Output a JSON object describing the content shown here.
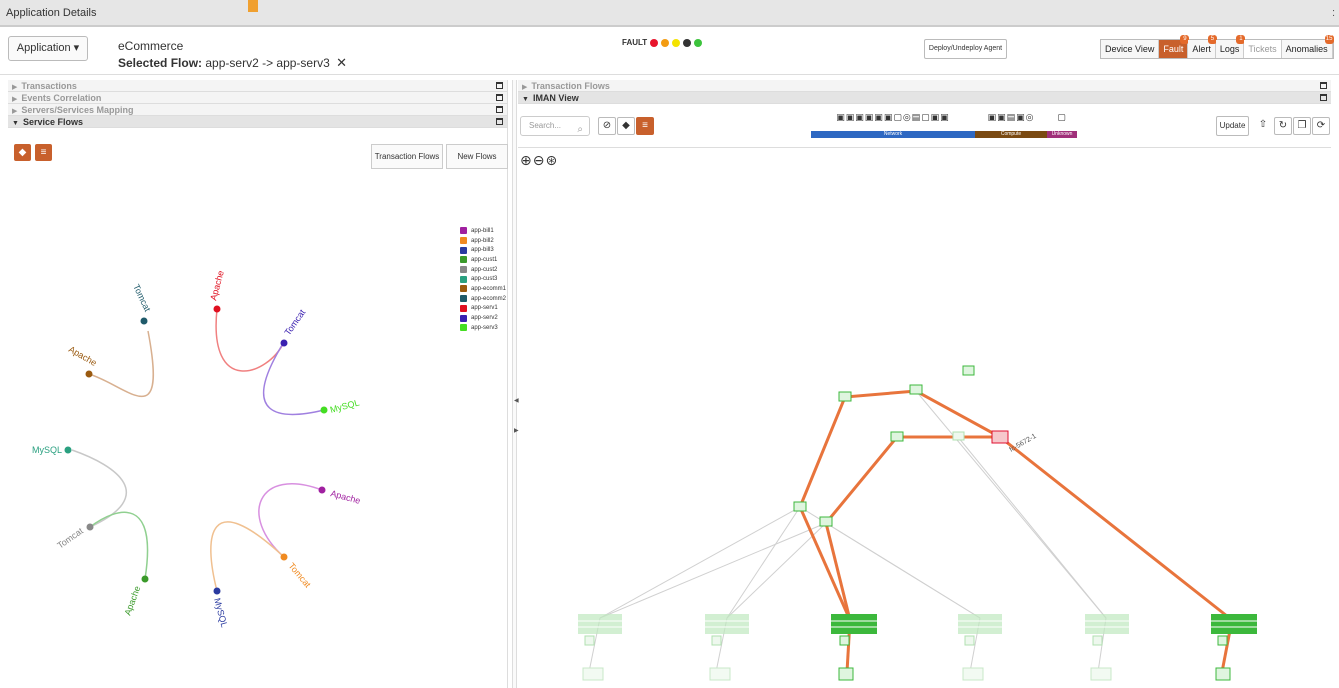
{
  "window": {
    "title": "Application Details",
    "close_symbol": ":"
  },
  "header": {
    "app_button": "Application ▾",
    "app_name": "eCommerce",
    "flow_label": "Selected Flow:",
    "flow_value": "app-serv2 -> app-serv3",
    "flow_clear": "✕",
    "fault_label": "FAULT",
    "fault_colors": [
      "#e8142c",
      "#f39c12",
      "#f4e300",
      "#333333",
      "#3cc33c"
    ],
    "deploy_label": "Deploy/Undeploy Agent",
    "views": [
      {
        "label": "Device View",
        "badge": "",
        "state": "normal"
      },
      {
        "label": "Fault",
        "badge": "9",
        "state": "active"
      },
      {
        "label": "Alert",
        "badge": "5",
        "state": "normal"
      },
      {
        "label": "Logs",
        "badge": "1",
        "state": "normal"
      },
      {
        "label": "Tickets",
        "badge": "",
        "state": "dim"
      },
      {
        "label": "Anomalies",
        "badge": "15",
        "state": "normal"
      }
    ]
  },
  "left_panel": {
    "sections": [
      {
        "label": "Transactions",
        "open": false
      },
      {
        "label": "Events Correlation",
        "open": false
      },
      {
        "label": "Servers/Services Mapping",
        "open": false
      },
      {
        "label": "Service Flows",
        "open": true
      }
    ],
    "tabs": {
      "transaction_flows": "Transaction Flows",
      "new_flows": "New Flows"
    },
    "legend": [
      {
        "name": "app-bill1",
        "color": "#a020a0"
      },
      {
        "name": "app-bill2",
        "color": "#f08a20"
      },
      {
        "name": "app-bill3",
        "color": "#2a3aa0"
      },
      {
        "name": "app-cust1",
        "color": "#3a9a2a"
      },
      {
        "name": "app-cust2",
        "color": "#888888"
      },
      {
        "name": "app-cust3",
        "color": "#2aa080"
      },
      {
        "name": "app-ecomm1",
        "color": "#9a5a10"
      },
      {
        "name": "app-ecomm2",
        "color": "#1f5a6a"
      },
      {
        "name": "app-serv1",
        "color": "#e01020"
      },
      {
        "name": "app-serv2",
        "color": "#3a20b0"
      },
      {
        "name": "app-serv3",
        "color": "#44dd22"
      }
    ],
    "flow_nodes": {
      "tomcat": "Tomcat",
      "apache": "Apache",
      "mysql": "MySQL"
    }
  },
  "right_panel": {
    "sections": [
      {
        "label": "Transaction Flows",
        "open": false
      },
      {
        "label": "IMAN View",
        "open": true
      }
    ],
    "search_placeholder": "Search...",
    "categories": [
      {
        "label": "Network",
        "color": "#2e68c2"
      },
      {
        "label": "Compute",
        "color": "#7a4a12"
      },
      {
        "label": "Unknown",
        "color": "#a0307a"
      }
    ],
    "update_label": "Update",
    "device_label": "fc-5672-1"
  }
}
